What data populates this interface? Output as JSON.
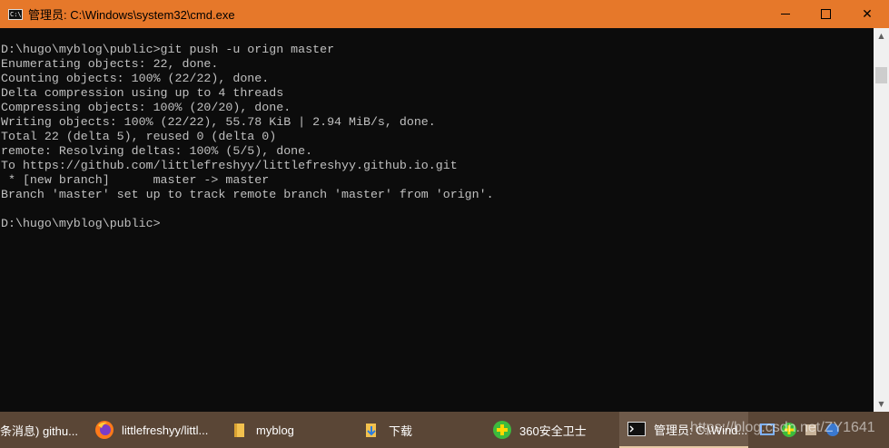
{
  "window": {
    "title": "管理员: C:\\Windows\\system32\\cmd.exe",
    "icon": "cmd-icon",
    "controls": {
      "minimize": "minimize-icon",
      "maximize": "maximize-icon",
      "close": "close-icon",
      "close_glyph": "✕"
    }
  },
  "console": {
    "lines": [
      "D:\\hugo\\myblog\\public>git push -u orign master",
      "Enumerating objects: 22, done.",
      "Counting objects: 100% (22/22), done.",
      "Delta compression using up to 4 threads",
      "Compressing objects: 100% (20/20), done.",
      "Writing objects: 100% (22/22), 55.78 KiB | 2.94 MiB/s, done.",
      "Total 22 (delta 5), reused 0 (delta 0)",
      "remote: Resolving deltas: 100% (5/5), done.",
      "To https://github.com/littlefreshyy/littlefreshyy.github.io.git",
      " * [new branch]      master -> master",
      "Branch 'master' set up to track remote branch 'master' from 'orign'.",
      "",
      "D:\\hugo\\myblog\\public>"
    ]
  },
  "scrollbar": {
    "up_glyph": "▲",
    "down_glyph": "▼"
  },
  "taskbar": {
    "items": [
      {
        "label": "条消息) githu...",
        "icon": "browser-tab-icon"
      },
      {
        "label": "littlefreshyy/littl...",
        "icon": "firefox-icon"
      },
      {
        "label": "myblog",
        "icon": "folder-icon"
      },
      {
        "label": "下载",
        "icon": "download-folder-icon"
      },
      {
        "label": "360安全卫士",
        "icon": "360-security-icon"
      },
      {
        "label": "管理员: C:\\Wind...",
        "icon": "cmd-icon",
        "active": true
      }
    ],
    "tray_icons": [
      "network-icon",
      "360-tray-icon",
      "tray-app-icon",
      "tray-app-icon-2"
    ],
    "watermark": "https://blog.csdn.net/ZY1641"
  },
  "colors": {
    "titlebar": "#e6782a",
    "console_bg": "#0c0c0c",
    "console_text": "#c0c0c0",
    "taskbar": "#5a4636"
  }
}
